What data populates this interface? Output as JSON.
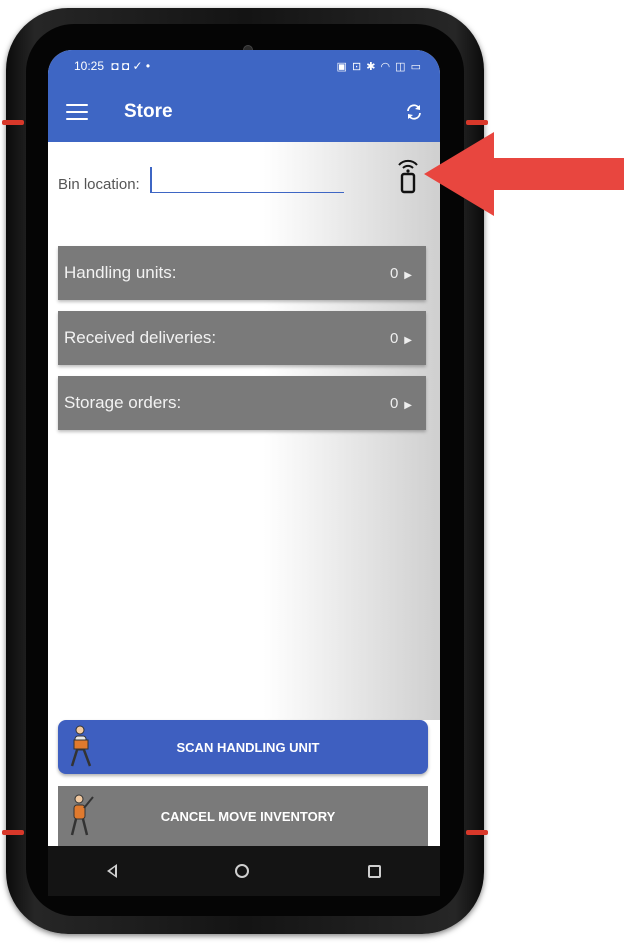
{
  "status_bar": {
    "time": "10:25",
    "left_icons": "◘ ◘ ✓ •",
    "right_icons": "▣ ⊡ ✱ ◠ ◫ ▭"
  },
  "app_bar": {
    "title": "Store",
    "menu_icon": "menu-icon",
    "refresh_icon": "refresh-icon"
  },
  "bin": {
    "label": "Bin location:",
    "value": "",
    "scanner_icon": "scanner-icon"
  },
  "rows": [
    {
      "label": "Handling units:",
      "count": "0"
    },
    {
      "label": "Received deliveries:",
      "count": "0"
    },
    {
      "label": "Storage orders:",
      "count": "0"
    }
  ],
  "buttons": {
    "scan": "SCAN HANDLING UNIT",
    "cancel": "CANCEL MOVE INVENTORY"
  },
  "colors": {
    "primary": "#3e66c4",
    "row_gray": "#7a7a7a",
    "arrow": "#e8463f"
  },
  "nav": {
    "back": "back-icon",
    "home": "home-icon",
    "recent": "recent-apps-icon"
  }
}
